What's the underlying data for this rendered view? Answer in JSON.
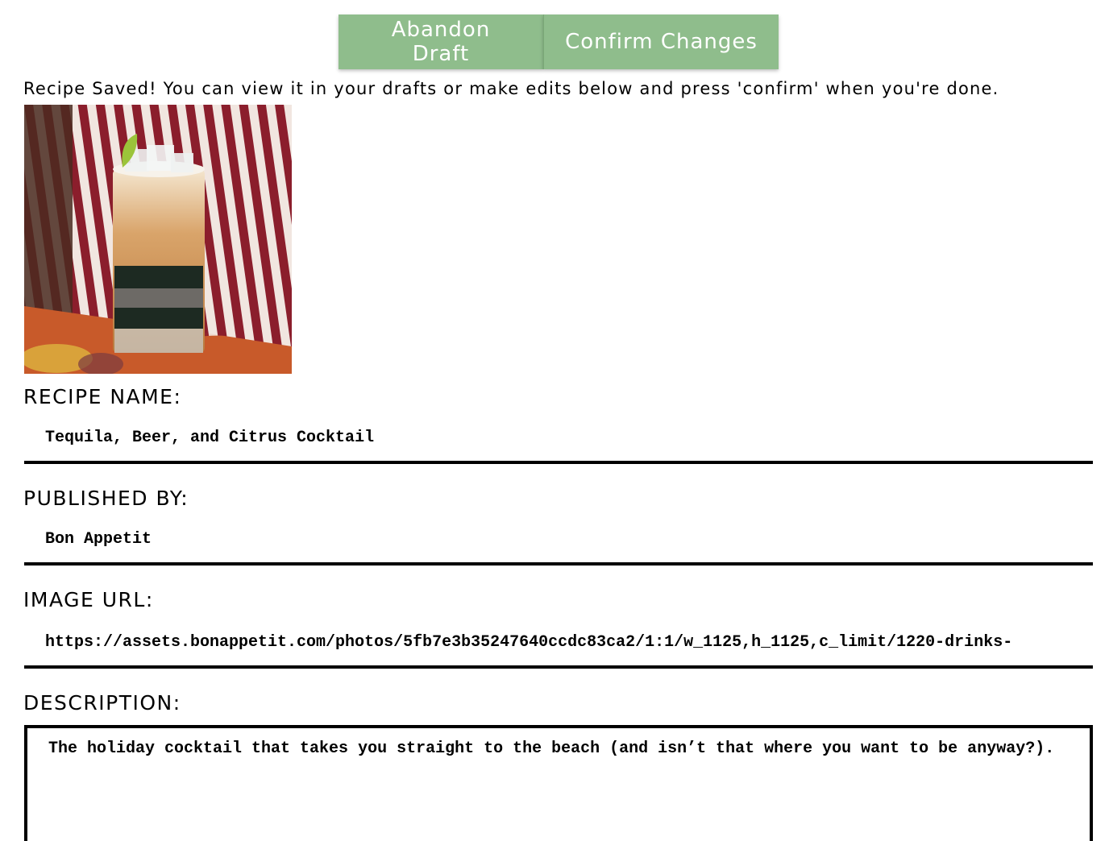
{
  "toolbar": {
    "abandon_label": "Abandon Draft",
    "confirm_label": "Confirm Changes"
  },
  "status_message": "Recipe Saved! You can view it in your drafts or make edits below and press 'confirm' when you're done.",
  "colors": {
    "button_bg": "#8fbd8c",
    "button_text": "#ffffff"
  },
  "form": {
    "recipe_name": {
      "label": "RECIPE NAME:",
      "value": "Tequila, Beer, and Citrus Cocktail"
    },
    "published_by": {
      "label": "PUBLISHED BY:",
      "value": "Bon Appetit"
    },
    "image_url": {
      "label": "IMAGE URL:",
      "value": "https://assets.bonappetit.com/photos/5fb7e3b35247640ccdc83ca2/1:1/w_1125,h_1125,c_limit/1220-drinks-"
    },
    "description": {
      "label": "DESCRIPTION:",
      "value": "The holiday cocktail that takes you straight to the beach (and isn’t that where you want to be anyway?)."
    }
  }
}
